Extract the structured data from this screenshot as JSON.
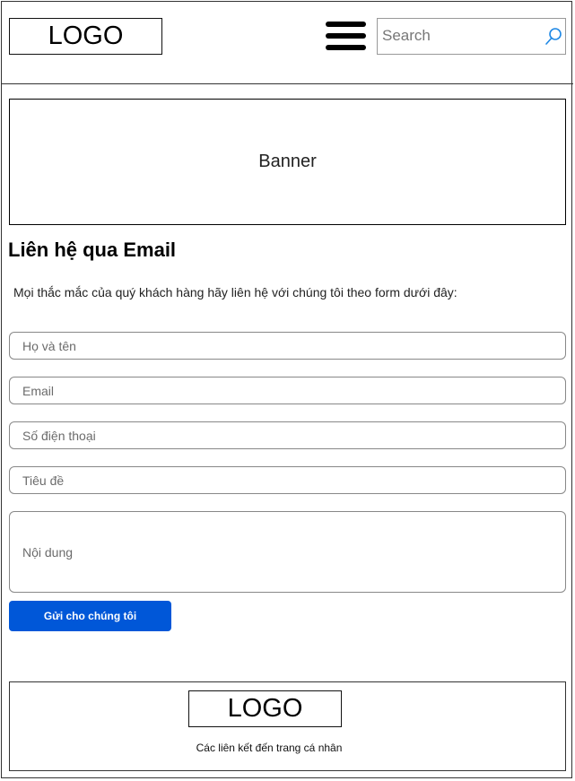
{
  "header": {
    "logo": "LOGO",
    "search": {
      "placeholder": "Search",
      "icon": "search-icon"
    },
    "menu_icon": "hamburger-menu-icon"
  },
  "banner": {
    "label": "Banner"
  },
  "contact": {
    "title": "Liên hệ qua Email",
    "intro": "Mọi thắc mắc của quý khách hàng hãy liên hệ với chúng tôi theo form dưới đây:",
    "fields": {
      "name": {
        "placeholder": "Họ và tên"
      },
      "email": {
        "placeholder": "Email"
      },
      "phone": {
        "placeholder": "Số điện thoại"
      },
      "subject": {
        "placeholder": "Tiêu đề"
      },
      "message": {
        "placeholder": "Nội dung"
      }
    },
    "submit_label": "Gửi cho chúng tôi",
    "accent_color": "#0057d8"
  },
  "footer": {
    "logo": "LOGO",
    "links_text": "Các liên kết đến trang cá nhân"
  }
}
